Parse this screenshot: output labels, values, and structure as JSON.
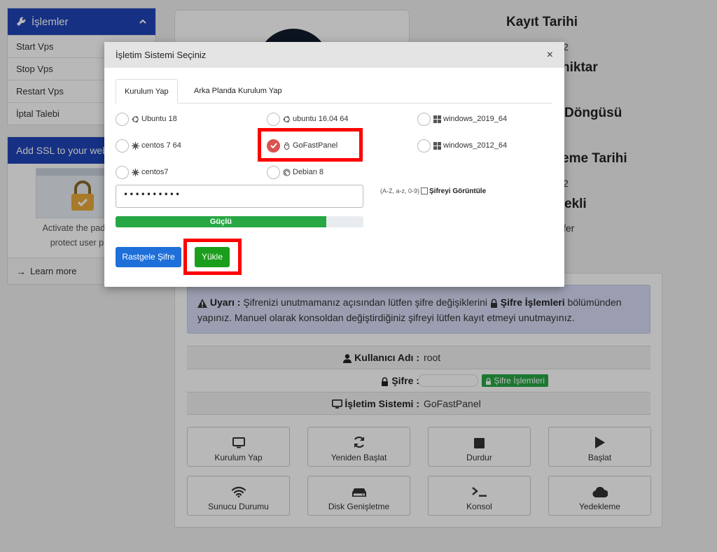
{
  "sidebar": {
    "header": "İşlemler",
    "items": [
      {
        "label": "Start Vps"
      },
      {
        "label": "Stop Vps"
      },
      {
        "label": "Restart Vps"
      },
      {
        "label": "İptal Talebi"
      }
    ],
    "ssl": {
      "header": "Add SSL to your web",
      "text_line1": "Activate the padlock",
      "text_line2": "protect user priv",
      "learn_more": "Learn more"
    }
  },
  "details": {
    "labels": [
      {
        "text": "Kayıt Tarihi"
      },
      {
        "text": "2"
      },
      {
        "text": "niktar"
      },
      {
        "text": "Döngüsü"
      },
      {
        "text": "eme Tarihi"
      },
      {
        "text": "2"
      },
      {
        "text": "ekli"
      },
      {
        "text": "fer"
      }
    ]
  },
  "warning": {
    "prefix": "Uyarı :",
    "text1": "Şifrenizi unutmamanız açısından lütfen şifre değişiklerini",
    "bold": "Şifre İşlemleri",
    "text2": "bölümünden",
    "text3": "yapınız. Manuel olarak konsoldan değiştirdiğiniz şifreyi lütfen kayıt etmeyi unutmayınız."
  },
  "info": {
    "username_label": "Kullanıcı Adı :",
    "username": "root",
    "password_label": "Şifre :",
    "password_button": "Şifre İşlemleri",
    "os_label": "İşletim Sistemi :",
    "os": "GoFastPanel"
  },
  "actions": [
    {
      "label": "Kurulum Yap",
      "icon": "monitor-icon"
    },
    {
      "label": "Yeniden Başlat",
      "icon": "refresh-icon"
    },
    {
      "label": "Durdur",
      "icon": "stop-icon"
    },
    {
      "label": "Başlat",
      "icon": "play-icon"
    },
    {
      "label": "Sunucu Durumu",
      "icon": "wifi-icon"
    },
    {
      "label": "Disk Genişletme",
      "icon": "hdd-icon"
    },
    {
      "label": "Konsol",
      "icon": "terminal-icon"
    },
    {
      "label": "Yedekleme",
      "icon": "cloud-icon"
    }
  ],
  "modal": {
    "title": "İşletim Sistemi Seçiniz",
    "close": "×",
    "tabs": [
      {
        "label": "Kurulum Yap",
        "active": true
      },
      {
        "label": "Arka Planda Kurulum Yap",
        "active": false
      }
    ],
    "os_options": [
      {
        "label": "Ubuntu 18",
        "icon": "ubuntu-icon",
        "checked": false
      },
      {
        "label": "ubuntu 16.04 64",
        "icon": "ubuntu-icon",
        "checked": false
      },
      {
        "label": "windows_2019_64",
        "icon": "windows-icon",
        "checked": false
      },
      {
        "label": "centos 7 64",
        "icon": "centos-icon",
        "checked": false
      },
      {
        "label": "GoFastPanel",
        "icon": "linux-icon",
        "checked": true
      },
      {
        "label": "windows_2012_64",
        "icon": "windows-icon",
        "checked": false
      },
      {
        "label": "centos7",
        "icon": "centos-icon",
        "checked": false
      },
      {
        "label": "Debian 8",
        "icon": "debian-icon",
        "checked": false
      }
    ],
    "password_value": "••••••••••",
    "password_hint": "(A-Z, a-z, 0-9)",
    "show_password_label": "Şifreyi Görüntüle",
    "strength": {
      "label": "Güçlü",
      "fraction": 0.85
    },
    "random_button": "Rastgele Şifre",
    "install_button": "Yükle"
  },
  "colors": {
    "primary": "#1f45b8",
    "success": "#28a745",
    "highlight": "#ff0000",
    "checked": "#d9534f"
  }
}
